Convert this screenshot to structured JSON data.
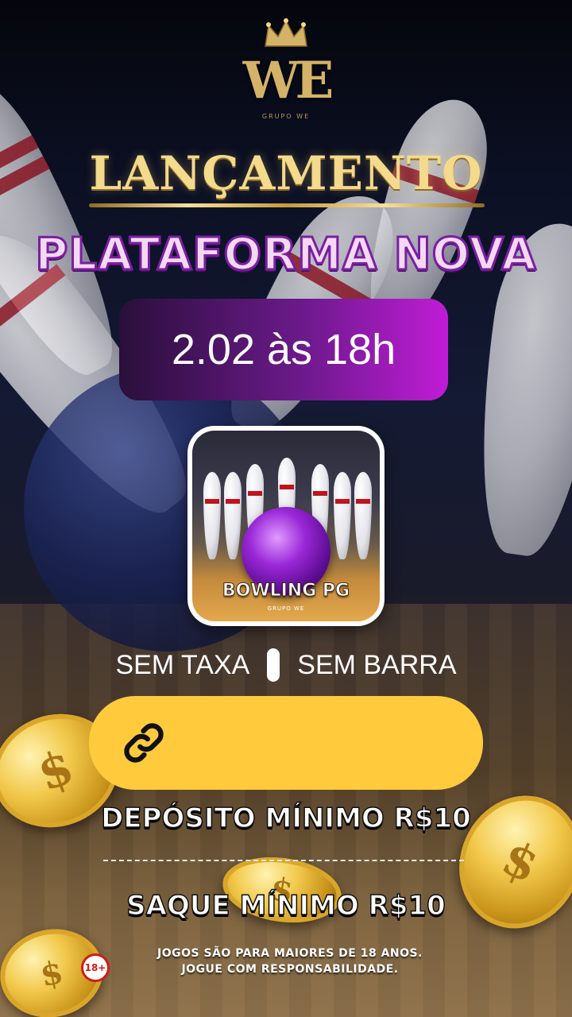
{
  "brand": {
    "logo_text": "WE",
    "logo_subtitle": "GRUPO WE"
  },
  "headline": {
    "launch": "LANÇAMENTO",
    "platform": "PLATAFORMA NOVA"
  },
  "event": {
    "date_time": "2.02 às 18h"
  },
  "game": {
    "title": "BOWLING PG",
    "subtitle": "GRUPO WE"
  },
  "features": {
    "left": "SEM TAXA",
    "right": "SEM BARRA"
  },
  "link_button": {
    "icon": "link-icon",
    "color": "#ffcb3d"
  },
  "limits": {
    "deposit": "DEPÓSITO MÍNIMO R$10",
    "withdraw": "SAQUE MÍNIMO R$10"
  },
  "footer": {
    "age_badge": "18+",
    "disclaimer_line1": "JOGOS SÃO PARA MAIORES DE 18 ANOS.",
    "disclaimer_line2": "JOGUE COM RESPONSABILIDADE."
  },
  "colors": {
    "gold": "#f3da8c",
    "purple": "#7b1fa2",
    "pill_gradient_end": "#c01cd6",
    "button_yellow": "#ffcb3d",
    "age_red": "#d21a1a"
  }
}
